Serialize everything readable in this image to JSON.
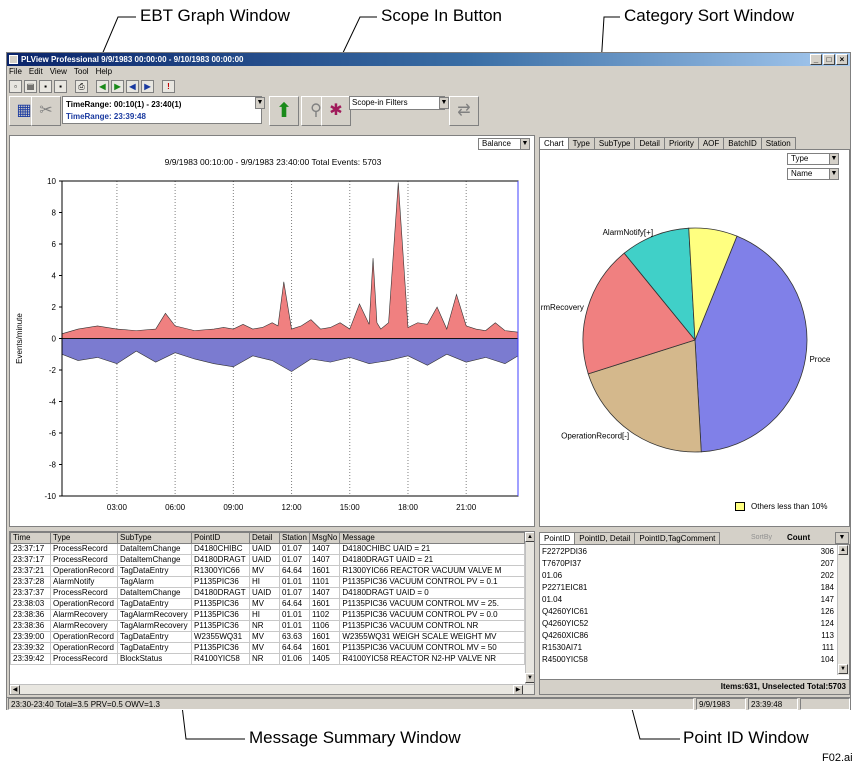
{
  "callouts": {
    "ebt": "EBT Graph Window",
    "scope_in": "Scope In Button",
    "category_sort": "Category Sort Window",
    "message_summary": "Message Summary Window",
    "point_id": "Point ID Window",
    "figure_id": "F02.ai"
  },
  "window": {
    "title": "PLView Professional 9/9/1983 00:00:00 - 9/10/1983 00:00:00",
    "menus": [
      "File",
      "Edit",
      "View",
      "Tool",
      "Help"
    ]
  },
  "toolbar": {
    "timerange_line1": "TimeRange: 00:10(1) - 23:40(1)",
    "timerange_line2": "TimeRange: 23:39:48",
    "scope_filter": "Scope-in Filters"
  },
  "ebt": {
    "mode": "Balance",
    "header": "9/9/1983 00:10:00 - 9/9/1983 23:40:00 Total Events: 5703"
  },
  "chart_data": [
    {
      "type": "area",
      "title": "9/9/1983 00:10:00 - 9/9/1983 23:40:00 Total Events: 5703",
      "ylabel": "Events/minute",
      "ylim": [
        -10,
        10
      ],
      "yticks": [
        10,
        8,
        6,
        4,
        2,
        0,
        -2,
        -4,
        -6,
        -8,
        -10
      ],
      "xticks": [
        "03:00",
        "06:00",
        "09:00",
        "12:00",
        "15:00",
        "18:00",
        "21:00"
      ],
      "xlim_hours": [
        0.17,
        23.67
      ],
      "series": [
        {
          "color": "#f08080",
          "x": [
            0.17,
            1,
            2,
            3,
            4,
            5,
            5.5,
            6,
            7,
            8,
            8.5,
            9,
            9.5,
            10,
            10.5,
            11,
            11.3,
            11.6,
            12,
            12.5,
            13,
            13.5,
            14,
            14.5,
            15,
            15.5,
            16,
            16.2,
            16.4,
            16.6,
            17,
            17.5,
            18,
            18.5,
            19,
            19.5,
            20,
            20.5,
            21,
            21.5,
            22,
            22.5,
            23,
            23.67
          ],
          "values": [
            0.3,
            0.6,
            0.8,
            0.6,
            0.5,
            0.6,
            1.6,
            0.8,
            0.5,
            0.6,
            0.7,
            0.6,
            0.9,
            0.6,
            0.7,
            1.0,
            0.8,
            3.6,
            0.6,
            0.8,
            1.2,
            0.6,
            0.7,
            1.0,
            0.6,
            2.2,
            0.9,
            5.1,
            1.0,
            0.6,
            1.0,
            9.9,
            0.7,
            1.0,
            0.9,
            2.0,
            0.6,
            2.8,
            0.8,
            0.6,
            0.5,
            1.0,
            0.5,
            0.4
          ]
        },
        {
          "color": "#7b7bd0",
          "x": [
            0.17,
            1,
            2,
            3,
            4,
            5,
            6,
            7,
            8,
            9,
            10,
            11,
            12,
            13,
            14,
            15,
            16,
            17,
            18,
            19,
            20,
            21,
            22,
            23,
            23.67
          ],
          "values": [
            -1.0,
            -1.4,
            -1.2,
            -1.6,
            -0.8,
            -1.5,
            -0.9,
            -1.3,
            -1.6,
            -1.8,
            -1.1,
            -1.4,
            -2.1,
            -1.3,
            -1.5,
            -1.2,
            -1.6,
            -1.4,
            -1.1,
            -1.7,
            -1.0,
            -1.5,
            -1.2,
            -1.6,
            -1.1
          ]
        }
      ]
    },
    {
      "type": "pie",
      "labels": [
        "Proce",
        "OperationRecord[-]",
        "rmRecovery",
        "AlarmNotify[+]",
        "Others less than 10%"
      ],
      "values": [
        43,
        21,
        19,
        10,
        7
      ],
      "colors": [
        "#8080e8",
        "#d4b88c",
        "#f08080",
        "#40d0c8",
        "#ffff80"
      ],
      "legend": "Others less than 10%"
    }
  ],
  "category": {
    "tabs": [
      "Chart",
      "Type",
      "SubType",
      "Detail",
      "Priority",
      "AOF",
      "BatchID",
      "Station"
    ],
    "sel1": "Type",
    "sel2": "Name",
    "legend_label": "Others less than 10%"
  },
  "messages": {
    "columns": [
      "Time",
      "Type",
      "SubType",
      "PointID",
      "Detail",
      "Station",
      "MsgNo",
      "Message"
    ],
    "rows": [
      [
        "23:37:17",
        "ProcessRecord",
        "DataItemChange",
        "D4180CHIBC",
        "UAID",
        "01.07",
        "1407",
        "D4180CHIBC UAID = 21"
      ],
      [
        "23:37:17",
        "ProcessRecord",
        "DataItemChange",
        "D4180DRAGT",
        "UAID",
        "01.07",
        "1407",
        "D4180DRAGT UAID = 21"
      ],
      [
        "23:37:21",
        "OperationRecord",
        "TagDataEntry",
        "R1300YIC66",
        "MV",
        "64.64",
        "1601",
        "R1300YIC66 REACTOR VACUUM VALVE M"
      ],
      [
        "23:37:28",
        "AlarmNotify",
        "TagAlarm",
        "P1135PIC36",
        "HI",
        "01.01",
        "1101",
        "P1135PIC36 VACUUM CONTROL PV = 0.1"
      ],
      [
        "23:37:37",
        "ProcessRecord",
        "DataItemChange",
        "D4180DRAGT",
        "UAID",
        "01.07",
        "1407",
        "D4180DRAGT UAID = 0"
      ],
      [
        "23:38:03",
        "OperationRecord",
        "TagDataEntry",
        "P1135PIC36",
        "MV",
        "64.64",
        "1601",
        "P1135PIC36 VACUUM CONTROL MV = 25."
      ],
      [
        "23:38:36",
        "AlarmRecovery",
        "TagAlarmRecovery",
        "P1135PIC36",
        "HI",
        "01.01",
        "1102",
        "P1135PIC36 VACUUM CONTROL PV = 0.0"
      ],
      [
        "23:38:36",
        "AlarmRecovery",
        "TagAlarmRecovery",
        "P1135PIC36",
        "NR",
        "01.01",
        "1106",
        "P1135PIC36 VACUUM CONTROL NR"
      ],
      [
        "23:39:00",
        "OperationRecord",
        "TagDataEntry",
        "W2355WQ31",
        "MV",
        "63.63",
        "1601",
        "W2355WQ31 WEIGH SCALE WEIGHT MV"
      ],
      [
        "23:39:32",
        "OperationRecord",
        "TagDataEntry",
        "P1135PIC36",
        "MV",
        "64.64",
        "1601",
        "P1135PIC36 VACUUM CONTROL MV = 50"
      ],
      [
        "23:39:42",
        "ProcessRecord",
        "BlockStatus",
        "R4100YIC58",
        "NR",
        "01.06",
        "1405",
        "R4100YIC58 REACTOR N2-HP VALVE NR"
      ]
    ]
  },
  "points": {
    "tabs": [
      "PointID",
      "PointID, Detail",
      "PointID,TagComment"
    ],
    "sort_label": "SortBy",
    "count_label": "Count",
    "rows": [
      [
        "F2272PDI36",
        "306"
      ],
      [
        "T7670PI37",
        "207"
      ],
      [
        "01.06",
        "202"
      ],
      [
        "P2271EIC81",
        "184"
      ],
      [
        "01.04",
        "147"
      ],
      [
        "Q4260YIC61",
        "126"
      ],
      [
        "Q4260YIC52",
        "124"
      ],
      [
        "Q4260XIC86",
        "113"
      ],
      [
        "R1530AI71",
        "111"
      ],
      [
        "R4500YIC58",
        "104"
      ]
    ],
    "footer": "Items:631, Unselected Total:5703"
  },
  "status": {
    "left": "23:30-23:40 Total=3.5 PRV=0.5 OWV=1.3",
    "date": "9/9/1983",
    "time": "23:39:48"
  }
}
